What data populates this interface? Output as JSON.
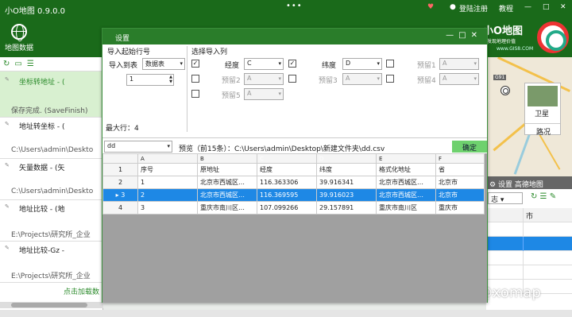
{
  "app": {
    "title": "小O地图 0.9.0.0",
    "login": "登陆注册",
    "tutorial": "教程"
  },
  "toolbar": {
    "map_data_label": "地图数据"
  },
  "brand": {
    "name": "小O地图",
    "slogan": "发现地理价值",
    "url": "www.GIS8.COM"
  },
  "tasks": [
    {
      "title": "坐标转地址 - (",
      "status": "保存完成. (SaveFinish)"
    },
    {
      "title": "地址转坐标 - (",
      "status": "C:\\Users\\admin\\Deskto"
    },
    {
      "title": "矢量数据 - (矢",
      "status": "C:\\Users\\admin\\Deskto"
    },
    {
      "title": "地址比较 - (地",
      "status": "E:\\Projects\\研究所_企业"
    },
    {
      "title": "地址比较-Gz -",
      "status": "E:\\Projects\\研究所_企业"
    }
  ],
  "left_panel": {
    "load_more": "点击加载数",
    "side_clip": "总"
  },
  "map": {
    "satellite_label": "卫星",
    "road_label": "路况",
    "tag": "G91",
    "bottom_bar": "设置 高德地图",
    "combo_suffix": "志",
    "grid_header": "市"
  },
  "dialog": {
    "title": "设置",
    "import_start_label": "导入起始行号",
    "import_to_label": "导入到表",
    "import_to_value": "数据表",
    "start_row_value": "1",
    "select_columns_label": "选择导入列",
    "max_rows": "最大行：4",
    "columns": [
      {
        "label": "经度",
        "value": "C",
        "checked": true
      },
      {
        "label": "纬度",
        "value": "D",
        "checked": true
      },
      {
        "label": "预留1",
        "value": "A",
        "checked": false
      },
      {
        "label": "预留2",
        "value": "A",
        "checked": false
      },
      {
        "label": "预留3",
        "value": "A",
        "checked": false
      },
      {
        "label": "预留4",
        "value": "A",
        "checked": false
      },
      {
        "label": "预留5",
        "value": "A",
        "checked": false
      }
    ],
    "sheet_value": "dd",
    "preview_text": "预览（前15条）：C:\\Users\\admin\\Desktop\\新建文件夹\\dd.csv",
    "ok_label": "确定",
    "grid": {
      "col_letters": [
        "A",
        "B",
        "C",
        "D",
        "E",
        "F"
      ],
      "rows": [
        {
          "num": "1",
          "cells": [
            "序号",
            "原地址",
            "经度",
            "纬度",
            "格式化地址",
            "省"
          ]
        },
        {
          "num": "2",
          "cells": [
            "1",
            "北京市西城区…",
            "116.363306",
            "39.916341",
            "北京市西城区…",
            "北京市"
          ]
        },
        {
          "num": "3",
          "cells": [
            "2",
            "北京市西城区…",
            "116.369595",
            "39.916023",
            "北京市西城区…",
            "北京市"
          ]
        },
        {
          "num": "4",
          "cells": [
            "3",
            "重庆市南川区…",
            "107.099266",
            "29.157891",
            "重庆市南川区",
            "重庆市"
          ]
        }
      ]
    }
  },
  "watermark": "知乎 @xomap"
}
